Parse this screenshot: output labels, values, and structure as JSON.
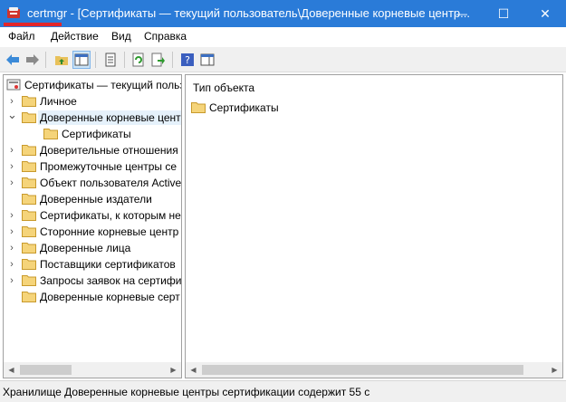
{
  "window": {
    "app_name": "certmgr",
    "title": "certmgr - [Сертификаты — текущий пользователь\\Доверенные корневые центр...",
    "minimize": "—",
    "maximize": "☐",
    "close": "✕",
    "accent": "#2a7bd8"
  },
  "menu": {
    "file": "Файл",
    "action": "Действие",
    "view": "Вид",
    "help": "Справка"
  },
  "toolbar": {
    "icons": [
      "back-arrow-icon",
      "forward-arrow-icon",
      "up-folder-icon",
      "show-hide-tree-icon",
      "properties-icon",
      "refresh-icon",
      "export-list-icon",
      "help-icon",
      "mmc-icon"
    ]
  },
  "tree": {
    "root": "Сертификаты — текущий польз",
    "items": [
      {
        "label": "Личное"
      },
      {
        "label": "Доверенные корневые цент"
      },
      {
        "label": "Сертификаты"
      },
      {
        "label": "Доверительные отношения"
      },
      {
        "label": "Промежуточные центры се"
      },
      {
        "label": "Объект пользователя Active"
      },
      {
        "label": "Доверенные издатели"
      },
      {
        "label": "Сертификаты, к которым не"
      },
      {
        "label": "Сторонние корневые центр"
      },
      {
        "label": "Доверенные лица"
      },
      {
        "label": "Поставщики сертификатов"
      },
      {
        "label": "Запросы заявок на сертифи"
      },
      {
        "label": "Доверенные корневые серт"
      }
    ]
  },
  "right": {
    "column_header": "Тип объекта",
    "items": [
      {
        "label": "Сертификаты"
      }
    ]
  },
  "status": {
    "text": "Хранилище Доверенные корневые центры сертификации содержит 55 с"
  }
}
